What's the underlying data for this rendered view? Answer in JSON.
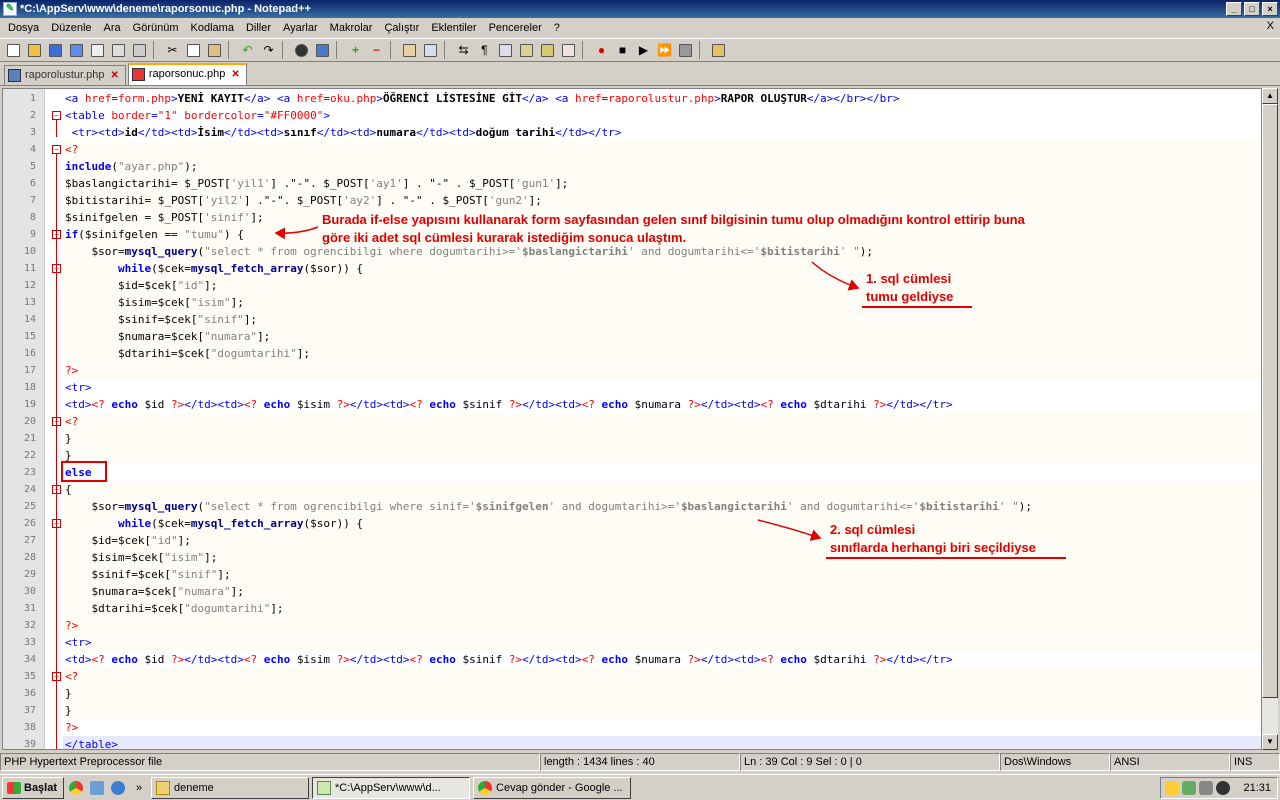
{
  "window": {
    "title": "*C:\\AppServ\\www\\deneme\\raporsonuc.php - Notepad++"
  },
  "menu": [
    "Dosya",
    "Düzenle",
    "Ara",
    "Görünüm",
    "Kodlama",
    "Diller",
    "Ayarlar",
    "Makrolar",
    "Çalıştır",
    "Eklentiler",
    "Pencereler",
    "?"
  ],
  "menu_close": "X",
  "tabs": [
    {
      "label": "raporolustur.php"
    },
    {
      "label": "raporsonuc.php"
    }
  ],
  "lines": [
    [
      [
        "t",
        "<a "
      ],
      [
        "a",
        "href"
      ],
      [
        "t",
        "="
      ],
      [
        "ph",
        "form.php"
      ],
      [
        "t",
        ">"
      ],
      [
        "b",
        "YENİ KAYIT"
      ],
      [
        "t",
        "</a> <a "
      ],
      [
        "a",
        "href"
      ],
      [
        "t",
        "="
      ],
      [
        "ph",
        "oku.php"
      ],
      [
        "t",
        ">"
      ],
      [
        "b",
        "ÖĞRENCİ LİSTESİNE GİT"
      ],
      [
        "t",
        "</a> <a "
      ],
      [
        "a",
        "href"
      ],
      [
        "t",
        "="
      ],
      [
        "ph",
        "raporolustur.php"
      ],
      [
        "t",
        ">"
      ],
      [
        "b",
        "RAPOR OLUŞTUR"
      ],
      [
        "t",
        "</a></br></br>"
      ]
    ],
    [
      [
        "t",
        "<table "
      ],
      [
        "a",
        "border"
      ],
      [
        "t",
        "="
      ],
      [
        "ph",
        "\"1\""
      ],
      [
        "t",
        " "
      ],
      [
        "a",
        "bordercolor"
      ],
      [
        "t",
        "="
      ],
      [
        "ph",
        "\"#FF0000\""
      ],
      [
        "t",
        ">"
      ]
    ],
    [
      [
        "t",
        " <tr><td>"
      ],
      [
        "b",
        "id"
      ],
      [
        "t",
        "</td><td>"
      ],
      [
        "b",
        "İsim"
      ],
      [
        "t",
        "</td><td>"
      ],
      [
        "b",
        "sınıf"
      ],
      [
        "t",
        "</td><td>"
      ],
      [
        "b",
        "numara"
      ],
      [
        "t",
        "</td><td>"
      ],
      [
        "b",
        "doğum tarihi"
      ],
      [
        "t",
        "</td></tr>"
      ]
    ],
    [
      [
        "ph",
        "<?"
      ]
    ],
    [
      [
        "k",
        "include"
      ],
      [
        "v",
        "("
      ],
      [
        "s",
        "\"ayar.php\""
      ],
      [
        "v",
        ");"
      ]
    ],
    [
      [
        "v",
        "$baslangictarihi= $_POST["
      ],
      [
        "s",
        "'yil1'"
      ],
      [
        "v",
        "] .\"-\". $_POST["
      ],
      [
        "s",
        "'ay1'"
      ],
      [
        "v",
        "] . \"-\" . $_POST["
      ],
      [
        "s",
        "'gun1'"
      ],
      [
        "v",
        "];"
      ]
    ],
    [
      [
        "v",
        "$bitistarihi= $_POST["
      ],
      [
        "s",
        "'yil2'"
      ],
      [
        "v",
        "] .\"-\". $_POST["
      ],
      [
        "s",
        "'ay2'"
      ],
      [
        "v",
        "] . \"-\" . $_POST["
      ],
      [
        "s",
        "'gun2'"
      ],
      [
        "v",
        "];"
      ]
    ],
    [
      [
        "v",
        "$sinifgelen = $_POST["
      ],
      [
        "s",
        "'sinif'"
      ],
      [
        "v",
        "];"
      ]
    ],
    [
      [
        "k",
        "if"
      ],
      [
        "v",
        "($sinifgelen == "
      ],
      [
        "s",
        "\"tumu\""
      ],
      [
        "v",
        ") {"
      ]
    ],
    [
      [
        "v",
        "    $sor="
      ],
      [
        "f",
        "mysql_query"
      ],
      [
        "v",
        "("
      ],
      [
        "s",
        "\"select * from ogrencibilgi where dogumtarihi>='"
      ],
      [
        "vs",
        "$baslangictarihi"
      ],
      [
        "s",
        "' and dogumtarihi<='"
      ],
      [
        "vs",
        "$bitistarihi"
      ],
      [
        "s",
        "' \""
      ],
      [
        "v",
        ");"
      ]
    ],
    [
      [
        "v",
        "        "
      ],
      [
        "k",
        "while"
      ],
      [
        "v",
        "($cek="
      ],
      [
        "f",
        "mysql_fetch_array"
      ],
      [
        "v",
        "($sor)) {"
      ]
    ],
    [
      [
        "v",
        "        $id=$cek["
      ],
      [
        "s",
        "\"id\""
      ],
      [
        "v",
        "];"
      ]
    ],
    [
      [
        "v",
        "        $isim=$cek["
      ],
      [
        "s",
        "\"isim\""
      ],
      [
        "v",
        "];"
      ]
    ],
    [
      [
        "v",
        "        $sinif=$cek["
      ],
      [
        "s",
        "\"sinif\""
      ],
      [
        "v",
        "];"
      ]
    ],
    [
      [
        "v",
        "        $numara=$cek["
      ],
      [
        "s",
        "\"numara\""
      ],
      [
        "v",
        "];"
      ]
    ],
    [
      [
        "v",
        "        $dtarihi=$cek["
      ],
      [
        "s",
        "\"dogumtarihi\""
      ],
      [
        "v",
        "];"
      ]
    ],
    [
      [
        "ph",
        "?>"
      ]
    ],
    [
      [
        "t",
        "<tr>"
      ]
    ],
    [
      [
        "t",
        "<td>"
      ],
      [
        "ph",
        "<?"
      ],
      [
        "v",
        " "
      ],
      [
        "k",
        "echo"
      ],
      [
        "v",
        " $id "
      ],
      [
        "ph",
        "?>"
      ],
      [
        "t",
        "</td><td>"
      ],
      [
        "ph",
        "<?"
      ],
      [
        "v",
        " "
      ],
      [
        "k",
        "echo"
      ],
      [
        "v",
        " $isim "
      ],
      [
        "ph",
        "?>"
      ],
      [
        "t",
        "</td><td>"
      ],
      [
        "ph",
        "<?"
      ],
      [
        "v",
        " "
      ],
      [
        "k",
        "echo"
      ],
      [
        "v",
        " $sinif "
      ],
      [
        "ph",
        "?>"
      ],
      [
        "t",
        "</td><td>"
      ],
      [
        "ph",
        "<?"
      ],
      [
        "v",
        " "
      ],
      [
        "k",
        "echo"
      ],
      [
        "v",
        " $numara "
      ],
      [
        "ph",
        "?>"
      ],
      [
        "t",
        "</td><td>"
      ],
      [
        "ph",
        "<?"
      ],
      [
        "v",
        " "
      ],
      [
        "k",
        "echo"
      ],
      [
        "v",
        " $dtarihi "
      ],
      [
        "ph",
        "?>"
      ],
      [
        "t",
        "</td></tr>"
      ]
    ],
    [
      [
        "ph",
        "<?"
      ]
    ],
    [
      [
        "v",
        "}"
      ]
    ],
    [
      [
        "v",
        "}"
      ]
    ],
    [
      [
        "k",
        "else"
      ]
    ],
    [
      [
        "v",
        "{"
      ]
    ],
    [
      [
        "v",
        "    $sor="
      ],
      [
        "f",
        "mysql_query"
      ],
      [
        "v",
        "("
      ],
      [
        "s",
        "\"select * from ogrencibilgi where sinif='"
      ],
      [
        "vs",
        "$sinifgelen"
      ],
      [
        "s",
        "' and dogumtarihi>='"
      ],
      [
        "vs",
        "$baslangictarihi"
      ],
      [
        "s",
        "' and dogumtarihi<='"
      ],
      [
        "vs",
        "$bitistarihi"
      ],
      [
        "s",
        "' \""
      ],
      [
        "v",
        ");"
      ]
    ],
    [
      [
        "v",
        "        "
      ],
      [
        "k",
        "while"
      ],
      [
        "v",
        "($cek="
      ],
      [
        "f",
        "mysql_fetch_array"
      ],
      [
        "v",
        "($sor)) {"
      ]
    ],
    [
      [
        "v",
        "    $id=$cek["
      ],
      [
        "s",
        "\"id\""
      ],
      [
        "v",
        "];"
      ]
    ],
    [
      [
        "v",
        "    $isim=$cek["
      ],
      [
        "s",
        "\"isim\""
      ],
      [
        "v",
        "];"
      ]
    ],
    [
      [
        "v",
        "    $sinif=$cek["
      ],
      [
        "s",
        "\"sinif\""
      ],
      [
        "v",
        "];"
      ]
    ],
    [
      [
        "v",
        "    $numara=$cek["
      ],
      [
        "s",
        "\"numara\""
      ],
      [
        "v",
        "];"
      ]
    ],
    [
      [
        "v",
        "    $dtarihi=$cek["
      ],
      [
        "s",
        "\"dogumtarihi\""
      ],
      [
        "v",
        "];"
      ]
    ],
    [
      [
        "ph",
        "?>"
      ]
    ],
    [
      [
        "t",
        "<tr>"
      ]
    ],
    [
      [
        "t",
        "<td>"
      ],
      [
        "ph",
        "<?"
      ],
      [
        "v",
        " "
      ],
      [
        "k",
        "echo"
      ],
      [
        "v",
        " $id "
      ],
      [
        "ph",
        "?>"
      ],
      [
        "t",
        "</td><td>"
      ],
      [
        "ph",
        "<?"
      ],
      [
        "v",
        " "
      ],
      [
        "k",
        "echo"
      ],
      [
        "v",
        " $isim "
      ],
      [
        "ph",
        "?>"
      ],
      [
        "t",
        "</td><td>"
      ],
      [
        "ph",
        "<?"
      ],
      [
        "v",
        " "
      ],
      [
        "k",
        "echo"
      ],
      [
        "v",
        " $sinif "
      ],
      [
        "ph",
        "?>"
      ],
      [
        "t",
        "</td><td>"
      ],
      [
        "ph",
        "<?"
      ],
      [
        "v",
        " "
      ],
      [
        "k",
        "echo"
      ],
      [
        "v",
        " $numara "
      ],
      [
        "ph",
        "?>"
      ],
      [
        "t",
        "</td><td>"
      ],
      [
        "ph",
        "<?"
      ],
      [
        "v",
        " "
      ],
      [
        "k",
        "echo"
      ],
      [
        "v",
        " $dtarihi "
      ],
      [
        "ph",
        "?>"
      ],
      [
        "t",
        "</td></tr>"
      ]
    ],
    [
      [
        "ph",
        "<?"
      ]
    ],
    [
      [
        "v",
        "}"
      ]
    ],
    [
      [
        "v",
        "}"
      ]
    ],
    [
      [
        "ph",
        "?>"
      ]
    ],
    [
      [
        "t",
        "</table>"
      ]
    ]
  ],
  "annotations": {
    "note1": "Burada if-else yapısını kullanarak form sayfasından gelen sınıf bilgisinin tumu olup olmadığını kontrol ettirip buna",
    "note2": "göre iki adet sql cümlesi kurarak istediğim sonuca ulaştım.",
    "sql1a": "1. sql cümlesi",
    "sql1b": "tumu  geldiyse",
    "sql2a": "2. sql cümlesi",
    "sql2b": "sınıflarda herhangi biri seçildiyse"
  },
  "status": {
    "type": "PHP Hypertext Preprocessor file",
    "length": "length : 1434    lines : 40",
    "pos": "Ln : 39    Col : 9    Sel : 0 | 0",
    "eol": "Dos\\Windows",
    "enc": "ANSI",
    "mode": "INS"
  },
  "taskbar": {
    "start": "Başlat",
    "tasks": [
      "deneme",
      "*C:\\AppServ\\www\\d...",
      "Cevap gönder - Google ..."
    ],
    "clock": "21:31"
  }
}
